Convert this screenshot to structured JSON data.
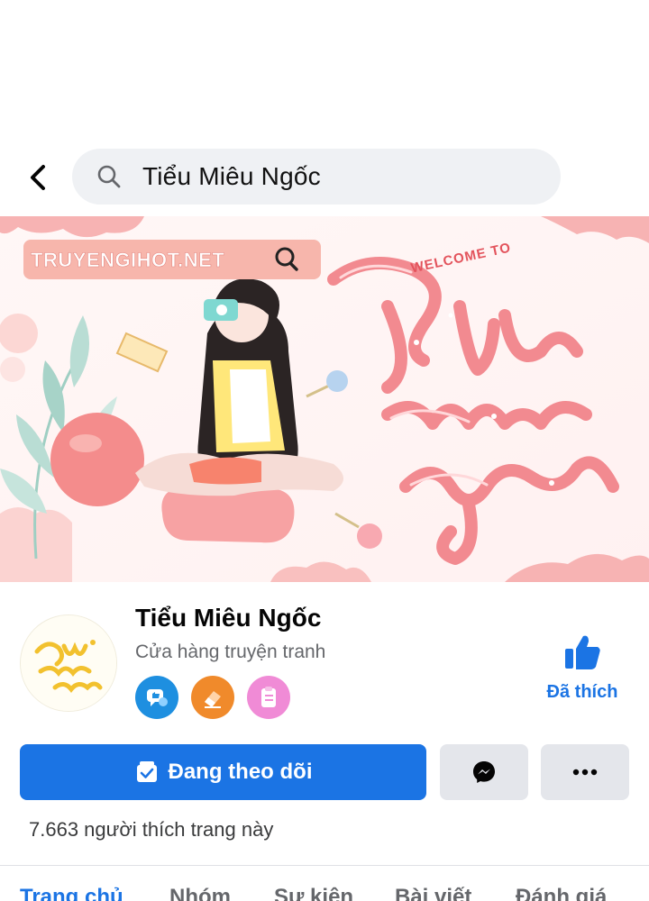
{
  "search": {
    "query": "Tiểu Miêu Ngốc"
  },
  "cover": {
    "url_text": "TRUYENGIHOT.NET",
    "welcome_text": "WELCOME TO"
  },
  "page": {
    "name": "Tiểu Miêu Ngốc",
    "category": "Cửa hàng truyện tranh",
    "like_label": "Đã thích",
    "likes_text": "7.663 người thích trang này",
    "badges": [
      "chat-like-badge-icon",
      "eraser-badge-icon",
      "clipboard-badge-icon"
    ]
  },
  "actions": {
    "follow_label": "Đang theo dõi",
    "messenger_icon": "messenger-icon",
    "more_icon": "more-icon"
  },
  "tabs": [
    {
      "label": "Trang chủ",
      "active": true
    },
    {
      "label": "Nhóm",
      "active": false
    },
    {
      "label": "Sự kiện",
      "active": false
    },
    {
      "label": "Bài viết",
      "active": false
    },
    {
      "label": "Đánh giá",
      "active": false
    }
  ],
  "colors": {
    "accent": "#1b74e4",
    "cover_pink": "#f3878d"
  }
}
